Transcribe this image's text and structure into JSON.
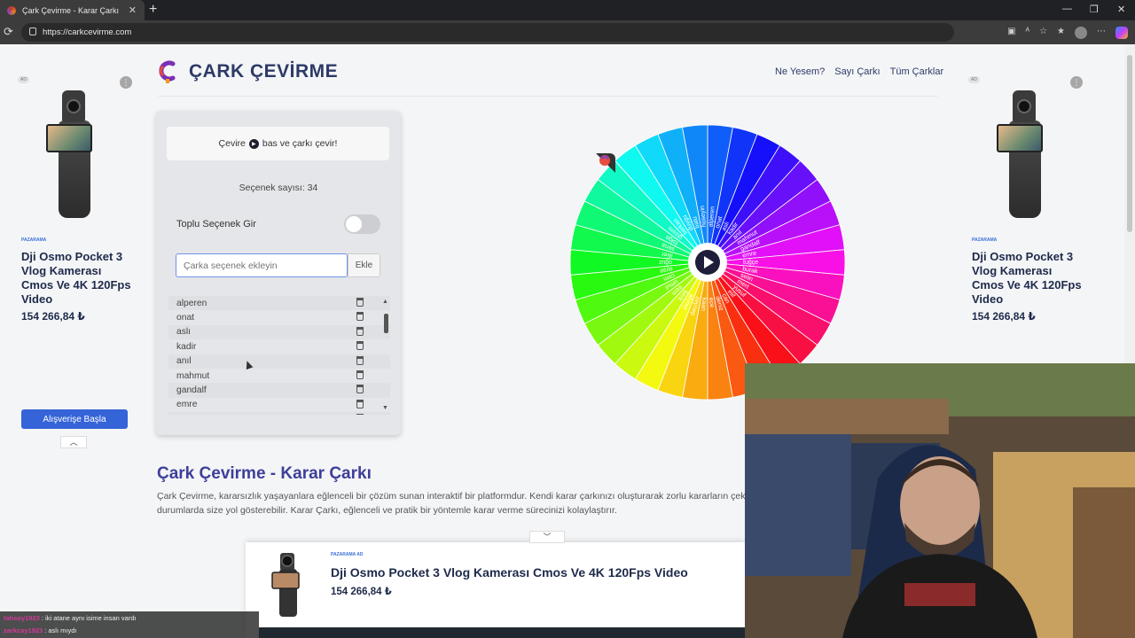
{
  "browser": {
    "tab_title": "Çark Çevirme - Karar Çarkı",
    "url": "https://carkcevirme.com"
  },
  "site": {
    "title": "ÇARK ÇEVİRME",
    "nav": [
      "Ne Yesem?",
      "Sayı Çarkı",
      "Tüm Çarklar"
    ]
  },
  "panel": {
    "hint_prefix": "Çevire",
    "hint_suffix": "bas ve çarkı çevir!",
    "option_count": "Seçenek sayısı: 34",
    "bulk_label": "Toplu Seçenek Gir",
    "bulk_enabled": false,
    "input_placeholder": "Çarka seçenek ekleyin",
    "add_label": "Ekle",
    "options": [
      "alperen",
      "onat",
      "aslı",
      "kadir",
      "anıl",
      "mahmut",
      "gandalf",
      "emre",
      "tuğçe"
    ]
  },
  "wheel": {
    "segment_count": 34,
    "labels": [
      "alperen",
      "onat",
      "aslı",
      "kadir",
      "anıl",
      "mahmut",
      "gandalf",
      "emre",
      "tuğçe",
      "burak",
      "selin",
      "mert",
      "yusuf",
      "elif",
      "can",
      "deniz",
      "ece",
      "kaan",
      "zeynep",
      "ahmet",
      "berk",
      "irem",
      "umut",
      "cem",
      "ayşe",
      "oğuz",
      "ilker",
      "sena",
      "tolga",
      "gizem",
      "serkan",
      "duygu",
      "batu",
      "hüseyin"
    ]
  },
  "ads": {
    "badge": "AD",
    "brand": "PAZARAMA",
    "product_title": "Dji Osmo Pocket 3 Vlog Kamerası Cmos Ve 4K 120Fps Video",
    "price": "154 266,84 ₺",
    "cta": "Alışverişe Başla"
  },
  "content": {
    "heading": "Çark Çevirme - Karar Çarkı",
    "description": "Çark Çevirme, kararsızlık yaşayanlara eğlenceli bir çözüm sunan interaktif bir platformdur. Kendi karar çarkınızı oluşturarak zorlu kararların çektiğiniz durumlarda size yol gösterebilir. Karar Çarkı, eğlenceli ve pratik bir yöntemle karar verme sürecinizi kolaylaştırır."
  },
  "chat": [
    {
      "user": "tahsoy1923",
      "text": ": iki atane aynı isime insan vardı"
    },
    {
      "user": "zarkcay1923",
      "text": ": aslı mıydı"
    }
  ]
}
